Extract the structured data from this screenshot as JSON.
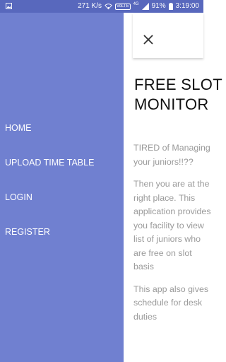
{
  "status_bar": {
    "network_speed": "271 K/s",
    "volte_badge": "VoLTE",
    "network_type": "4G",
    "battery": "91%",
    "time": "3:19:00"
  },
  "drawer": {
    "items": [
      {
        "label": "HOME"
      },
      {
        "label": "UPLOAD TIME TABLE"
      },
      {
        "label": "LOGIN"
      },
      {
        "label": "REGISTER"
      }
    ]
  },
  "page": {
    "title_line1": "FREE SLOT",
    "title_line2": "MONITOR",
    "paragraphs": [
      "TIRED of Managing your juniors!!??",
      "Then you are at the right place. This application provides you facility to view list of juniors who are free on slot basis",
      "This app also gives schedule for desk duties"
    ]
  },
  "colors": {
    "drawer_bg": "#7080d0",
    "status_bar_bg": "#5868bd"
  },
  "icons": [
    "image-icon",
    "wifi-icon",
    "signal-icon",
    "battery-icon",
    "close-icon"
  ]
}
